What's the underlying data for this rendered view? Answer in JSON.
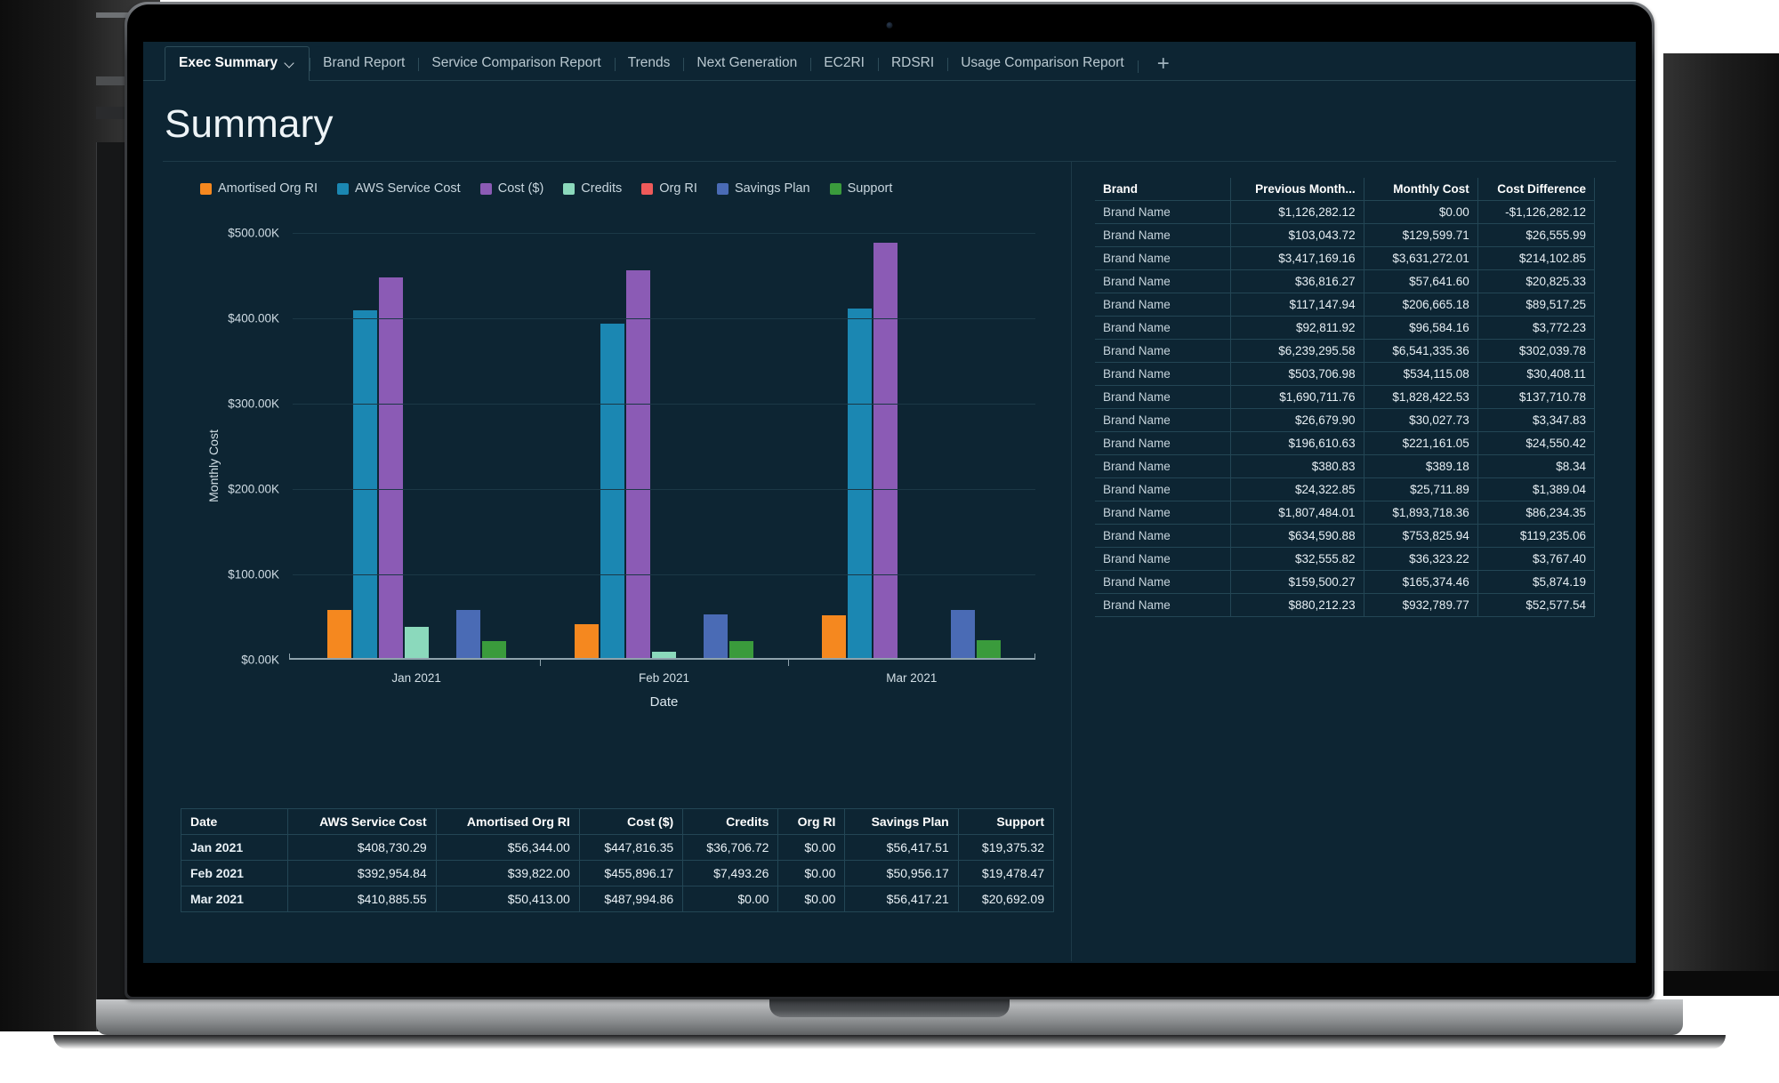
{
  "app": {
    "background_color": "#0d2533",
    "accent_color": "#1b87b2"
  },
  "tabs": [
    {
      "label": "Exec Summary",
      "active": true,
      "has_chevron": true
    },
    {
      "label": "Brand Report",
      "active": false
    },
    {
      "label": "Service Comparison Report",
      "active": false
    },
    {
      "label": "Trends",
      "active": false
    },
    {
      "label": "Next Generation",
      "active": false
    },
    {
      "label": "EC2RI",
      "active": false
    },
    {
      "label": "RDSRI",
      "active": false
    },
    {
      "label": "Usage Comparison Report",
      "active": false
    }
  ],
  "tab_add_label": "+",
  "page_title": "Summary",
  "chart_data": {
    "type": "bar",
    "title": "",
    "xlabel": "Date",
    "ylabel": "Monthly Cost",
    "categories": [
      "Jan 2021",
      "Feb 2021",
      "Mar 2021"
    ],
    "ylim": [
      0,
      500000
    ],
    "yticks": [
      0,
      100000,
      200000,
      300000,
      400000,
      500000
    ],
    "ytick_labels": [
      "$0.00K",
      "$100.00K",
      "$200.00K",
      "$300.00K",
      "$400.00K",
      "$500.00K"
    ],
    "grid": true,
    "legend_position": "top-left",
    "series": [
      {
        "name": "Amortised Org RI",
        "color": "#f5881f",
        "values": [
          56344.0,
          39822.0,
          50413.0
        ]
      },
      {
        "name": "AWS Service Cost",
        "color": "#1b87b2",
        "values": [
          408730.29,
          392954.84,
          410885.55
        ]
      },
      {
        "name": "Cost ($)",
        "color": "#8b5bb5",
        "values": [
          447816.35,
          455896.17,
          487994.86
        ]
      },
      {
        "name": "Credits",
        "color": "#8bd9bc",
        "values": [
          36706.72,
          7493.26,
          0.0
        ]
      },
      {
        "name": "Org RI",
        "color": "#ee5a5a",
        "values": [
          0.0,
          0.0,
          0.0
        ]
      },
      {
        "name": "Savings Plan",
        "color": "#4a6bb5",
        "values": [
          56417.51,
          50956.17,
          56417.21
        ]
      },
      {
        "name": "Support",
        "color": "#3a9b3c",
        "values": [
          19375.32,
          19478.47,
          20692.09
        ]
      }
    ]
  },
  "brand_table": {
    "headers": [
      "Brand",
      "Previous Month...",
      "Monthly Cost",
      "Cost Difference"
    ],
    "rows": [
      {
        "brand": "Brand Name",
        "previous": "$1,126,282.12",
        "monthly": "$0.00",
        "difference": "-$1,126,282.12"
      },
      {
        "brand": "Brand Name",
        "previous": "$103,043.72",
        "monthly": "$129,599.71",
        "difference": "$26,555.99"
      },
      {
        "brand": "Brand Name",
        "previous": "$3,417,169.16",
        "monthly": "$3,631,272.01",
        "difference": "$214,102.85"
      },
      {
        "brand": "Brand Name",
        "previous": "$36,816.27",
        "monthly": "$57,641.60",
        "difference": "$20,825.33"
      },
      {
        "brand": "Brand Name",
        "previous": "$117,147.94",
        "monthly": "$206,665.18",
        "difference": "$89,517.25"
      },
      {
        "brand": "Brand Name",
        "previous": "$92,811.92",
        "monthly": "$96,584.16",
        "difference": "$3,772.23"
      },
      {
        "brand": "Brand Name",
        "previous": "$6,239,295.58",
        "monthly": "$6,541,335.36",
        "difference": "$302,039.78"
      },
      {
        "brand": "Brand Name",
        "previous": "$503,706.98",
        "monthly": "$534,115.08",
        "difference": "$30,408.11"
      },
      {
        "brand": "Brand Name",
        "previous": "$1,690,711.76",
        "monthly": "$1,828,422.53",
        "difference": "$137,710.78"
      },
      {
        "brand": "Brand Name",
        "previous": "$26,679.90",
        "monthly": "$30,027.73",
        "difference": "$3,347.83"
      },
      {
        "brand": "Brand Name",
        "previous": "$196,610.63",
        "monthly": "$221,161.05",
        "difference": "$24,550.42"
      },
      {
        "brand": "Brand Name",
        "previous": "$380.83",
        "monthly": "$389.18",
        "difference": "$8.34"
      },
      {
        "brand": "Brand Name",
        "previous": "$24,322.85",
        "monthly": "$25,711.89",
        "difference": "$1,389.04"
      },
      {
        "brand": "Brand Name",
        "previous": "$1,807,484.01",
        "monthly": "$1,893,718.36",
        "difference": "$86,234.35"
      },
      {
        "brand": "Brand Name",
        "previous": "$634,590.88",
        "monthly": "$753,825.94",
        "difference": "$119,235.06"
      },
      {
        "brand": "Brand Name",
        "previous": "$32,555.82",
        "monthly": "$36,323.22",
        "difference": "$3,767.40"
      },
      {
        "brand": "Brand Name",
        "previous": "$159,500.27",
        "monthly": "$165,374.46",
        "difference": "$5,874.19"
      },
      {
        "brand": "Brand Name",
        "previous": "$880,212.23",
        "monthly": "$932,789.77",
        "difference": "$52,577.54"
      }
    ]
  },
  "summary_table": {
    "headers": [
      "Date",
      "AWS Service Cost",
      "Amortised Org RI",
      "Cost ($)",
      "Credits",
      "Org RI",
      "Savings Plan",
      "Support"
    ],
    "rows": [
      {
        "date": "Jan 2021",
        "aws_service_cost": "$408,730.29",
        "amortised_org_ri": "$56,344.00",
        "cost": "$447,816.35",
        "credits": "$36,706.72",
        "org_ri": "$0.00",
        "savings_plan": "$56,417.51",
        "support": "$19,375.32"
      },
      {
        "date": "Feb 2021",
        "aws_service_cost": "$392,954.84",
        "amortised_org_ri": "$39,822.00",
        "cost": "$455,896.17",
        "credits": "$7,493.26",
        "org_ri": "$0.00",
        "savings_plan": "$50,956.17",
        "support": "$19,478.47"
      },
      {
        "date": "Mar 2021",
        "aws_service_cost": "$410,885.55",
        "amortised_org_ri": "$50,413.00",
        "cost": "$487,994.86",
        "credits": "$0.00",
        "org_ri": "$0.00",
        "savings_plan": "$56,417.21",
        "support": "$20,692.09"
      }
    ]
  }
}
